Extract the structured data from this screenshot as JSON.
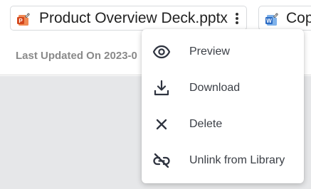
{
  "files": [
    {
      "name": "Product Overview Deck.pptx",
      "icon": "powerpoint-linked-icon",
      "icon_color": "#e8602c"
    },
    {
      "name": "Cop",
      "icon": "word-linked-icon",
      "icon_color": "#2b7cd3"
    }
  ],
  "meta": {
    "updated": "Last Updated On 2023-0"
  },
  "menu": {
    "items": [
      {
        "label": "Preview",
        "icon": "eye-icon"
      },
      {
        "label": "Download",
        "icon": "download-icon"
      },
      {
        "label": "Delete",
        "icon": "close-icon"
      },
      {
        "label": "Unlink from Library",
        "icon": "unlink-icon"
      }
    ]
  },
  "colors": {
    "text_dark": "#222222",
    "text_muted": "#8a8a8a",
    "menu_text": "#3b3f46",
    "content_bg": "#e6e7e9"
  }
}
